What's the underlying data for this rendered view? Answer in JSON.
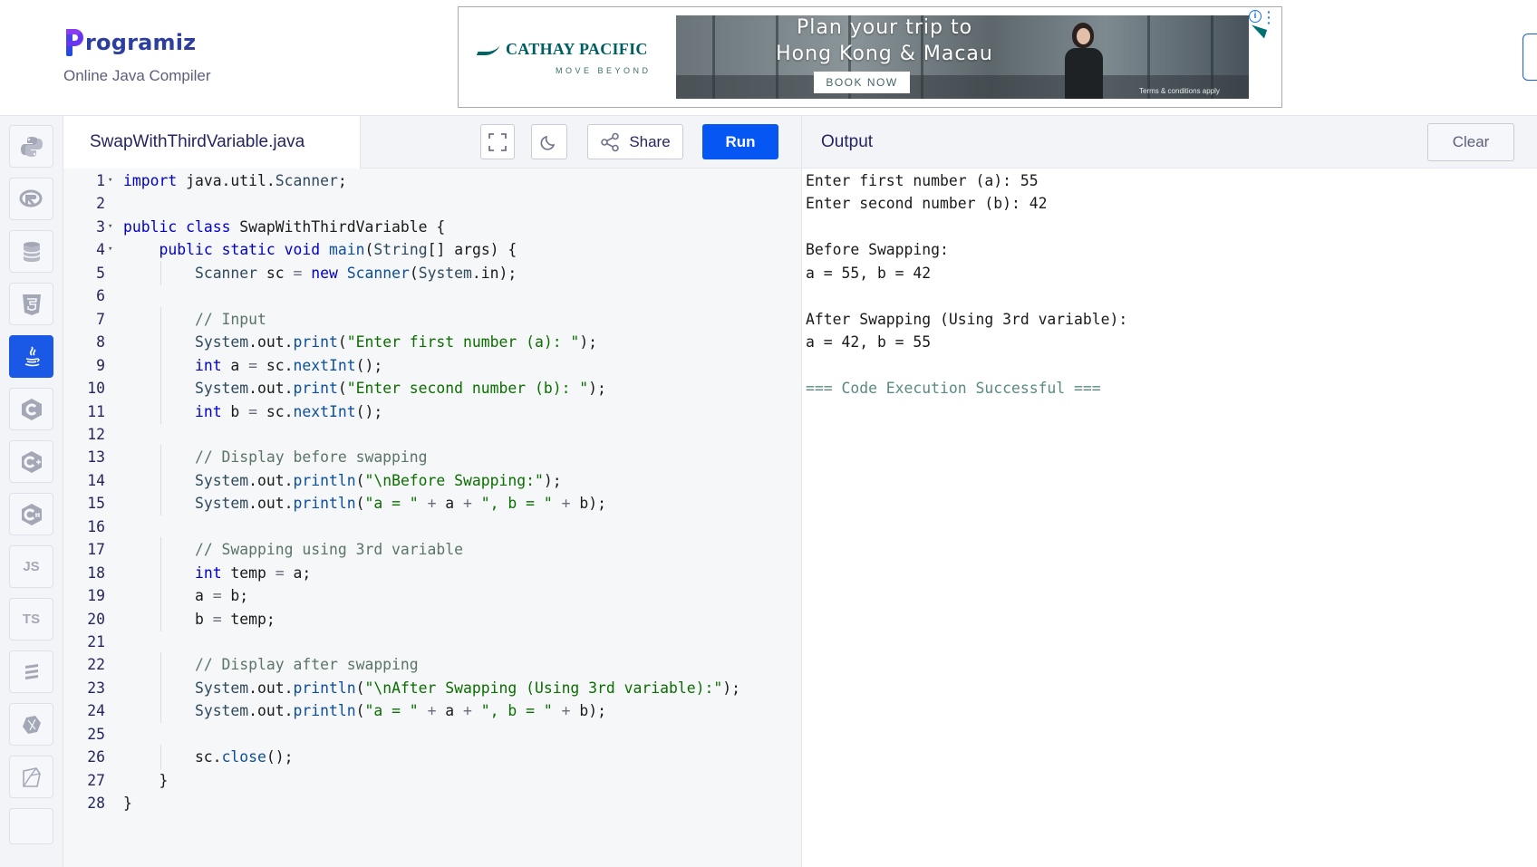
{
  "brand": {
    "name": "rogramiz",
    "subtitle": "Online Java Compiler"
  },
  "ad": {
    "brand_name": "CATHAY PACIFIC",
    "brand_tagline": "MOVE BEYOND",
    "headline_line1": "Plan your trip to",
    "headline_line2": "Hong Kong & Macau",
    "cta": "BOOK NOW",
    "terms": "Terms & conditions apply",
    "accent_color": "#005d63"
  },
  "sidebar": {
    "items": [
      {
        "name": "python",
        "icon": "python-icon",
        "label": ""
      },
      {
        "name": "r",
        "icon": "r-icon",
        "label": ""
      },
      {
        "name": "sql",
        "icon": "database-icon",
        "label": ""
      },
      {
        "name": "html",
        "icon": "html5-icon",
        "label": ""
      },
      {
        "name": "java",
        "icon": "java-icon",
        "label": "",
        "active": true
      },
      {
        "name": "c",
        "icon": "c-icon",
        "label": ""
      },
      {
        "name": "cpp",
        "icon": "cpp-icon",
        "label": ""
      },
      {
        "name": "csharp",
        "icon": "csharp-icon",
        "label": ""
      },
      {
        "name": "javascript",
        "icon": "js-icon",
        "label": "JS"
      },
      {
        "name": "typescript",
        "icon": "ts-icon",
        "label": "TS"
      },
      {
        "name": "swift",
        "icon": "swift-icon",
        "label": ""
      },
      {
        "name": "go",
        "icon": "go-icon",
        "label": ""
      },
      {
        "name": "php",
        "icon": "php-icon",
        "label": ""
      }
    ]
  },
  "editor": {
    "filename": "SwapWithThirdVariable.java",
    "share_label": "Share",
    "run_label": "Run",
    "lines": [
      "import java.util.Scanner;",
      "",
      "public class SwapWithThirdVariable {",
      "    public static void main(String[] args) {",
      "        Scanner sc = new Scanner(System.in);",
      "",
      "        // Input",
      "        System.out.print(\"Enter first number (a): \");",
      "        int a = sc.nextInt();",
      "        System.out.print(\"Enter second number (b): \");",
      "        int b = sc.nextInt();",
      "",
      "        // Display before swapping",
      "        System.out.println(\"\\nBefore Swapping:\");",
      "        System.out.println(\"a = \" + a + \", b = \" + b);",
      "",
      "        // Swapping using 3rd variable",
      "        int temp = a;",
      "        a = b;",
      "        b = temp;",
      "",
      "        // Display after swapping",
      "        System.out.println(\"\\nAfter Swapping (Using 3rd variable):\");",
      "        System.out.println(\"a = \" + a + \", b = \" + b);",
      "",
      "        sc.close();",
      "    }",
      "}"
    ],
    "fold_lines": [
      1,
      3,
      4
    ]
  },
  "output": {
    "title": "Output",
    "clear_label": "Clear",
    "lines": [
      "Enter first number (a): 55",
      "Enter second number (b): 42",
      "",
      "Before Swapping:",
      "a = 55, b = 42",
      "",
      "After Swapping (Using 3rd variable):",
      "a = 42, b = 55",
      "",
      "=== Code Execution Successful ==="
    ]
  }
}
